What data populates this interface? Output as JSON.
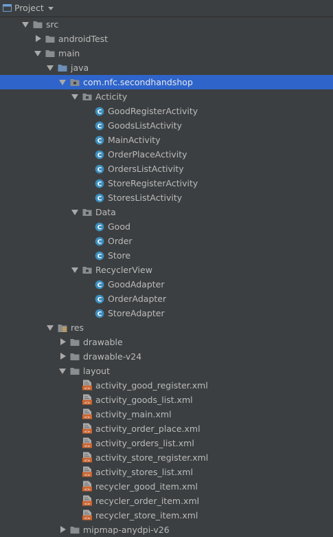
{
  "header": {
    "title": "Project"
  },
  "tree": [
    {
      "label": "src",
      "depth": 0,
      "expanded": true,
      "icon": "folder"
    },
    {
      "label": "androidTest",
      "depth": 1,
      "expanded": false,
      "icon": "folder"
    },
    {
      "label": "main",
      "depth": 1,
      "expanded": true,
      "icon": "folder"
    },
    {
      "label": "java",
      "depth": 2,
      "expanded": true,
      "icon": "folder-source"
    },
    {
      "label": "com.nfc.secondhandshop",
      "depth": 3,
      "expanded": true,
      "icon": "package",
      "selected": true
    },
    {
      "label": "Acticity",
      "depth": 4,
      "expanded": true,
      "icon": "package"
    },
    {
      "label": "GoodRegisterActivity",
      "depth": 5,
      "icon": "class"
    },
    {
      "label": "GoodsListActivity",
      "depth": 5,
      "icon": "class"
    },
    {
      "label": "MainActivity",
      "depth": 5,
      "icon": "class"
    },
    {
      "label": "OrderPlaceActivity",
      "depth": 5,
      "icon": "class"
    },
    {
      "label": "OrdersListActivity",
      "depth": 5,
      "icon": "class"
    },
    {
      "label": "StoreRegisterActivity",
      "depth": 5,
      "icon": "class"
    },
    {
      "label": "StoresListActivity",
      "depth": 5,
      "icon": "class"
    },
    {
      "label": "Data",
      "depth": 4,
      "expanded": true,
      "icon": "package"
    },
    {
      "label": "Good",
      "depth": 5,
      "icon": "class"
    },
    {
      "label": "Order",
      "depth": 5,
      "icon": "class"
    },
    {
      "label": "Store",
      "depth": 5,
      "icon": "class"
    },
    {
      "label": "RecyclerView",
      "depth": 4,
      "expanded": true,
      "icon": "package"
    },
    {
      "label": "GoodAdapter",
      "depth": 5,
      "icon": "class"
    },
    {
      "label": "OrderAdapter",
      "depth": 5,
      "icon": "class"
    },
    {
      "label": "StoreAdapter",
      "depth": 5,
      "icon": "class"
    },
    {
      "label": "res",
      "depth": 2,
      "expanded": true,
      "icon": "folder-resources"
    },
    {
      "label": "drawable",
      "depth": 3,
      "expanded": false,
      "icon": "folder"
    },
    {
      "label": "drawable-v24",
      "depth": 3,
      "expanded": false,
      "icon": "folder"
    },
    {
      "label": "layout",
      "depth": 3,
      "expanded": true,
      "icon": "folder"
    },
    {
      "label": "activity_good_register.xml",
      "depth": 4,
      "icon": "xml-file"
    },
    {
      "label": "activity_goods_list.xml",
      "depth": 4,
      "icon": "xml-file"
    },
    {
      "label": "activity_main.xml",
      "depth": 4,
      "icon": "xml-file"
    },
    {
      "label": "activity_order_place.xml",
      "depth": 4,
      "icon": "xml-file"
    },
    {
      "label": "activity_orders_list.xml",
      "depth": 4,
      "icon": "xml-file"
    },
    {
      "label": "activity_store_register.xml",
      "depth": 4,
      "icon": "xml-file"
    },
    {
      "label": "activity_stores_list.xml",
      "depth": 4,
      "icon": "xml-file"
    },
    {
      "label": "recycler_good_item.xml",
      "depth": 4,
      "icon": "xml-file"
    },
    {
      "label": "recycler_order_item.xml",
      "depth": 4,
      "icon": "xml-file"
    },
    {
      "label": "recycler_store_item.xml",
      "depth": 4,
      "icon": "xml-file"
    },
    {
      "label": "mipmap-anydpi-v26",
      "depth": 3,
      "expanded": false,
      "icon": "folder"
    }
  ],
  "colors": {
    "background": "#3c3f41",
    "selection": "#2f65ca",
    "class_icon": "#3d8fbf",
    "xml_icon": "#cc6633",
    "folder": "#8a8d90"
  }
}
